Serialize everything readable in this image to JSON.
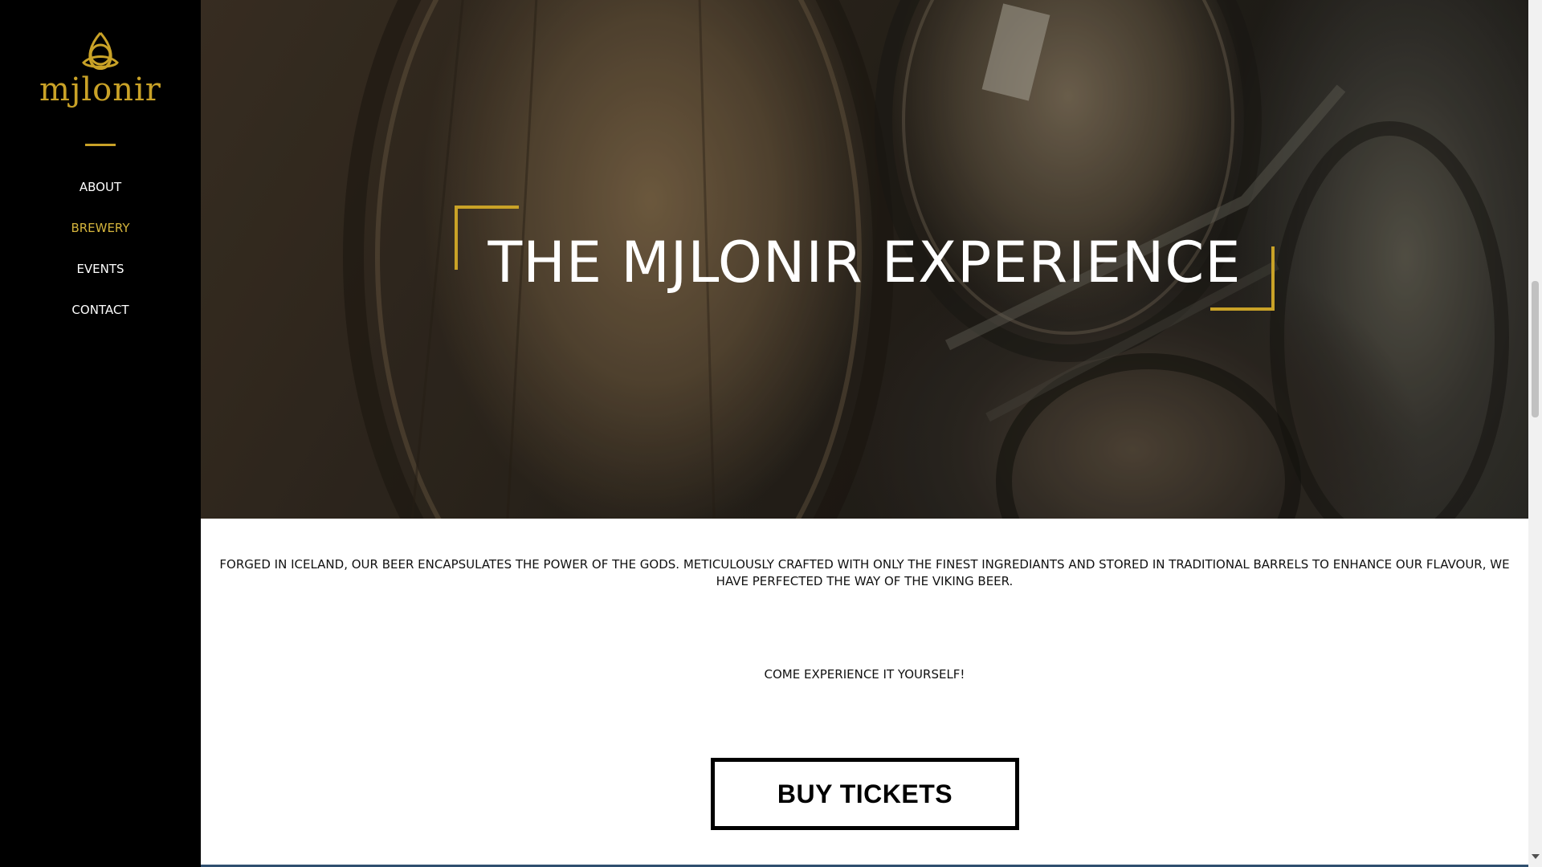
{
  "brand": {
    "name": "mjlonir",
    "logo_icon": "triquetra-icon",
    "accent_color": "#c9a227"
  },
  "nav": {
    "items": [
      {
        "label": "ABOUT",
        "active": false
      },
      {
        "label": "BREWERY",
        "active": true
      },
      {
        "label": "EVENTS",
        "active": false
      },
      {
        "label": "CONTACT",
        "active": false
      }
    ]
  },
  "hero": {
    "title": "THE MJLONIR EXPERIENCE",
    "background": "barrel-photo"
  },
  "content": {
    "intro": "FORGED IN ICELAND, OUR BEER ENCAPSULATES THE POWER OF THE GODS. METICULOUSLY CRAFTED WITH ONLY THE FINEST INGREDIANTS AND STORED IN TRADITIONAL BARRELS TO ENHANCE OUR FLAVOUR, WE HAVE PERFECTED THE WAY OF THE VIKING BEER.",
    "cta_text": "COME EXPERIENCE IT YOURSELF!",
    "button_label": "BUY TICKETS"
  }
}
